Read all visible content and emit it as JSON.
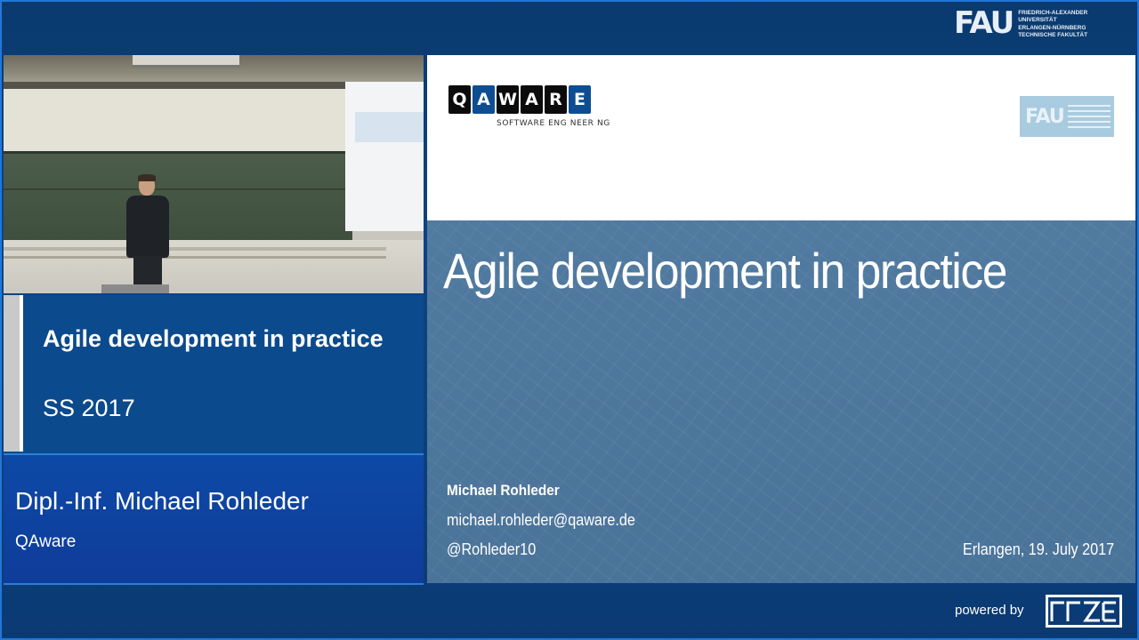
{
  "header": {
    "fau_logo": {
      "wordmark": "FAU",
      "text": "FRIEDRICH-ALEXANDER\nUNIVERSITÄT\nERLANGEN-NÜRNBERG\nTECHNISCHE FAKULTÄT"
    }
  },
  "lecture": {
    "title": "Agile development in practice",
    "semester": "SS 2017",
    "speaker": "Dipl.-Inf. Michael Rohleder",
    "affiliation": "QAware"
  },
  "slide": {
    "logo_letters": [
      "Q",
      "A",
      "W",
      "A",
      "R",
      "E"
    ],
    "logo_subtitle": "SOFTWARE ENG NEER NG",
    "fau_wordmark": "FAU",
    "title": "Agile development in practice",
    "author": "Michael Rohleder",
    "email": "michael.rohleder@qaware.de",
    "twitter": "@Rohleder10",
    "place_date": "Erlangen, 19. July 2017"
  },
  "footer": {
    "powered_by": "powered by",
    "logo_icon": "rrze-logo"
  },
  "colors": {
    "background": "#0c3d78",
    "title_block": "#0b4a8c",
    "speaker_block": "#0f3c9a",
    "slide_body": "#4d769c",
    "accent_line": "#2b7fd6"
  }
}
